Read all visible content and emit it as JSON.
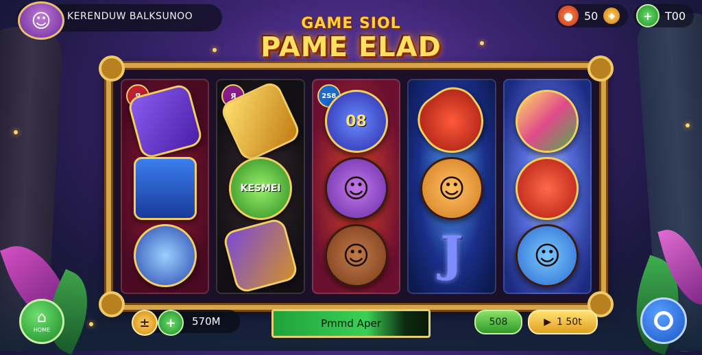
{
  "topbar": {
    "player_name": "KERENDUW BALKSUNOO",
    "coins_value": "50",
    "add_value": "T00"
  },
  "logo": {
    "line1": "GAME SIOL",
    "line2": "PAME ELAD"
  },
  "reels": [
    {
      "badge": "Я",
      "symbols": [
        "",
        "",
        ""
      ]
    },
    {
      "badge": "Я",
      "symbols": [
        "",
        "KESMEI",
        ""
      ]
    },
    {
      "badge": "2S8",
      "symbols": [
        "08",
        "",
        ""
      ]
    },
    {
      "badge": "",
      "symbols": [
        "",
        "",
        "J"
      ]
    },
    {
      "badge": "",
      "symbols": [
        "",
        "",
        ""
      ]
    }
  ],
  "bottombar": {
    "home_label": "HOME",
    "bet_value": "570M",
    "action_label": "Pmmd Aper",
    "win_label": "508",
    "spin_value": "1 50t"
  },
  "colors": {
    "frame_gold": "#d8a64a",
    "accent_green": "#3bd055",
    "accent_yellow": "#ffe070",
    "accent_blue": "#1a56c8"
  },
  "icons": [
    "avatar-icon",
    "coin-icon",
    "gem-icon",
    "plus-icon",
    "home-icon",
    "minus-icon",
    "plus-icon",
    "play-icon",
    "settings-icon"
  ]
}
